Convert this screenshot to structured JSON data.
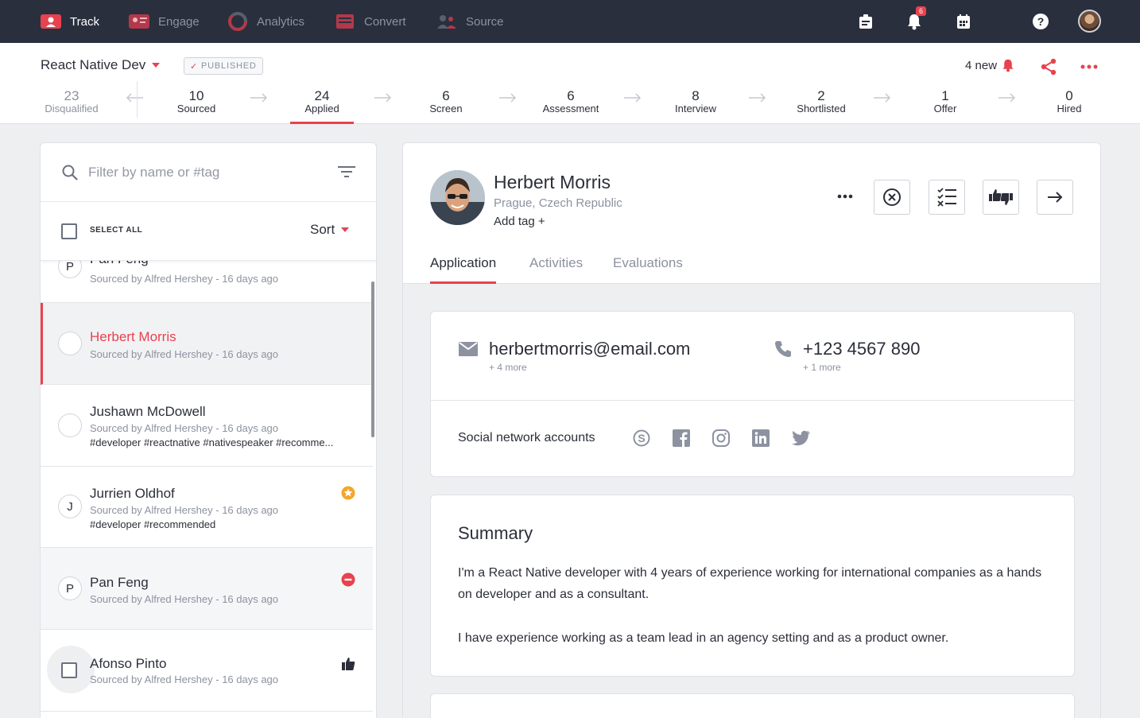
{
  "nav": {
    "items": [
      {
        "label": "Track",
        "icon": "track-icon"
      },
      {
        "label": "Engage",
        "icon": "engage-icon"
      },
      {
        "label": "Analytics",
        "icon": "analytics-icon"
      },
      {
        "label": "Convert",
        "icon": "convert-icon"
      },
      {
        "label": "Source",
        "icon": "source-icon"
      }
    ],
    "notification_count": "6"
  },
  "job": {
    "title": "React Native Dev",
    "status": "PUBLISHED",
    "new_count": "4 new"
  },
  "pipeline": [
    {
      "count": "23",
      "label": "Disqualified"
    },
    {
      "count": "10",
      "label": "Sourced"
    },
    {
      "count": "24",
      "label": "Applied"
    },
    {
      "count": "6",
      "label": "Screen"
    },
    {
      "count": "6",
      "label": "Assessment"
    },
    {
      "count": "8",
      "label": "Interview"
    },
    {
      "count": "2",
      "label": "Shortlisted"
    },
    {
      "count": "1",
      "label": "Offer"
    },
    {
      "count": "0",
      "label": "Hired"
    }
  ],
  "list": {
    "search_placeholder": "Filter by name or #tag",
    "select_all": "SELECT ALL",
    "sort_label": "Sort",
    "candidates": [
      {
        "name": "Pan Feng",
        "initial": "P",
        "meta": "Sourced by Alfred Hershey  -  16 days ago",
        "tags": ""
      },
      {
        "name": "Herbert Morris",
        "initial": "",
        "meta": "Sourced by Alfred Hershey  -  16 days ago",
        "tags": ""
      },
      {
        "name": "Jushawn McDowell",
        "initial": "",
        "meta": "Sourced by Alfred Hershey  -  16 days ago",
        "tags": "#developer  #reactnative  #nativespeaker  #recomme..."
      },
      {
        "name": "Jurrien Oldhof",
        "initial": "J",
        "meta": "Sourced by Alfred Hershey  -  16 days ago",
        "tags": "#developer  #recommended"
      },
      {
        "name": "Pan Feng",
        "initial": "P",
        "meta": "Sourced by Alfred Hershey  -  16 days ago",
        "tags": ""
      },
      {
        "name": "Afonso Pinto",
        "initial": "",
        "meta": "Sourced by Alfred Hershey  -  16 days ago",
        "tags": ""
      }
    ]
  },
  "detail": {
    "name": "Herbert Morris",
    "location": "Prague, Czech Republic",
    "add_tag": "Add tag +",
    "tabs": [
      "Application",
      "Activities",
      "Evaluations"
    ],
    "email": "herbertmorris@email.com",
    "email_more": "+ 4 more",
    "phone": "+123 4567 890",
    "phone_more": "+ 1 more",
    "social_label": "Social network accounts",
    "social": [
      "skype-icon",
      "facebook-icon",
      "instagram-icon",
      "linkedin-icon",
      "twitter-icon"
    ],
    "summary_title": "Summary",
    "summary_p1": "I'm a React Native developer with 4 years of experience working for international companies as a hands on developer and as a consultant.",
    "summary_p2": "I have experience working as a team lead in an agency setting and as a product owner."
  },
  "colors": {
    "accent": "#e8424f",
    "nav_bg": "#2a2f3d",
    "star": "#f4a62a"
  }
}
